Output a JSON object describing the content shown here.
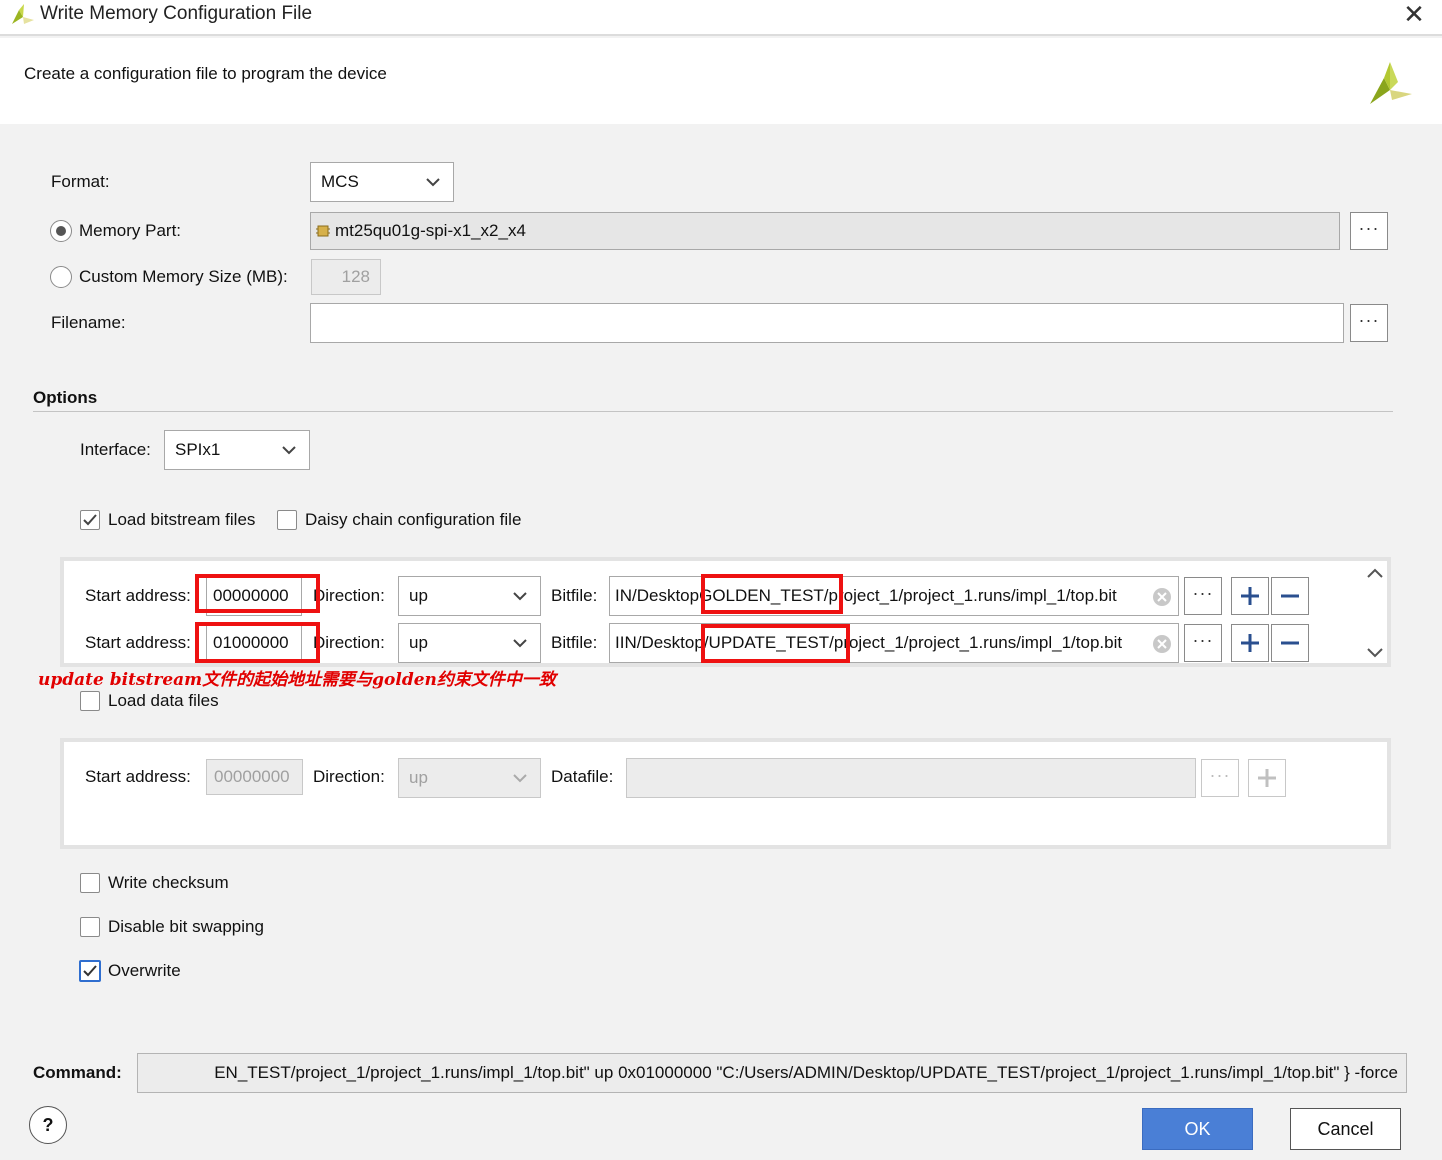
{
  "window": {
    "title": "Write Memory Configuration File",
    "close_glyph": "✕"
  },
  "header": {
    "subtitle": "Create a configuration file to program the device"
  },
  "format": {
    "label": "Format:",
    "value": "MCS"
  },
  "memory_part": {
    "label": "Memory Part:",
    "value": "mt25qu01g-spi-x1_x2_x4",
    "selected": true
  },
  "custom_memory": {
    "label": "Custom Memory Size (MB):",
    "value": "128",
    "selected": false
  },
  "filename": {
    "label": "Filename:",
    "value": ""
  },
  "options": {
    "title": "Options",
    "interface_label": "Interface:",
    "interface_value": "SPIx1",
    "load_bitstream": {
      "label": "Load bitstream files",
      "checked": true
    },
    "daisy_chain": {
      "label": "Daisy chain configuration file",
      "checked": false
    }
  },
  "bitstreams": [
    {
      "start_label": "Start address:",
      "start_value": "00000000",
      "direction_label": "Direction:",
      "direction_value": "up",
      "bitfile_label": "Bitfile:",
      "bitfile_prefix": "IN/Desktop",
      "bitfile_mark": "GOLDEN_TEST",
      "bitfile_suffix": "/project_1/project_1.runs/impl_1/top.bit"
    },
    {
      "start_label": "Start address:",
      "start_value": "01000000",
      "direction_label": "Direction:",
      "direction_value": "up",
      "bitfile_label": "Bitfile:",
      "bitfile_prefix": "IIN/Desktop",
      "bitfile_mark": "/UPDATE_TEST/",
      "bitfile_suffix": "project_1/project_1.runs/impl_1/top.bit"
    }
  ],
  "annotation": "update bitstream文件的起始地址需要与golden约束文件中一致",
  "load_data": {
    "label": "Load data files",
    "checked": false
  },
  "datafile_row": {
    "start_label": "Start address:",
    "start_value": "00000000",
    "direction_label": "Direction:",
    "direction_value": "up",
    "datafile_label": "Datafile:",
    "datafile_value": ""
  },
  "write_checksum": {
    "label": "Write checksum",
    "checked": false
  },
  "disable_bit_swapping": {
    "label": "Disable bit swapping",
    "checked": false
  },
  "overwrite": {
    "label": "Overwrite",
    "checked": true
  },
  "command": {
    "label": "Command:",
    "value": "EN_TEST/project_1/project_1.runs/impl_1/top.bit\" up 0x01000000 \"C:/Users/ADMIN/Desktop/UPDATE_TEST/project_1/project_1.runs/impl_1/top.bit\" } -force"
  },
  "buttons": {
    "help": "?",
    "ok": "OK",
    "cancel": "Cancel",
    "more": "···"
  },
  "colors": {
    "accent": "#4a7fd6",
    "annotation": "#e10000",
    "highlight_box": "#ee1111",
    "logo": "#9bb521"
  }
}
